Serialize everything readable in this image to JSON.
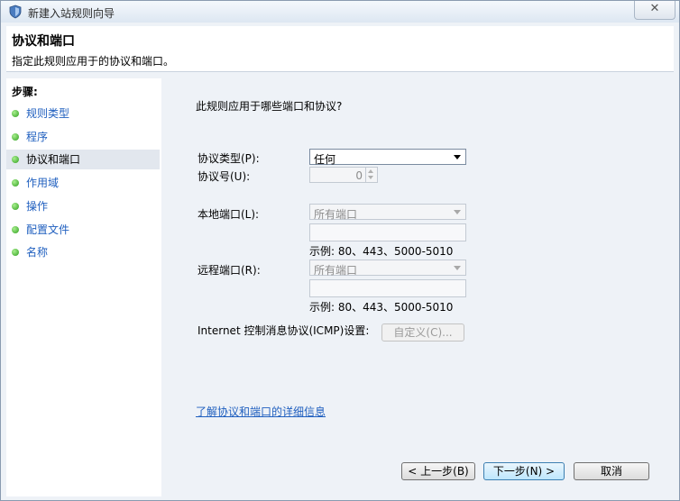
{
  "window": {
    "title": "新建入站规则向导",
    "close_symbol": "✕"
  },
  "header": {
    "title": "协议和端口",
    "subtitle": "指定此规则应用于的协议和端口。"
  },
  "sidebar": {
    "steps_label": "步骤:",
    "items": [
      {
        "label": "规则类型"
      },
      {
        "label": "程序"
      },
      {
        "label": "协议和端口"
      },
      {
        "label": "作用域"
      },
      {
        "label": "操作"
      },
      {
        "label": "配置文件"
      },
      {
        "label": "名称"
      }
    ],
    "current_index": 2
  },
  "form": {
    "question": "此规则应用于哪些端口和协议?",
    "protocol_type_label": "协议类型(P):",
    "protocol_type_value": "任何",
    "protocol_number_label": "协议号(U):",
    "protocol_number_value": "0",
    "local_port_label": "本地端口(L):",
    "local_port_value": "所有端口",
    "local_example": "示例: 80、443、5000-5010",
    "remote_port_label": "远程端口(R):",
    "remote_port_value": "所有端口",
    "remote_example": "示例: 80、443、5000-5010",
    "icmp_label": "Internet 控制消息协议(ICMP)设置:",
    "customize_button": "自定义(C)...",
    "learn_more_link": "了解协议和端口的详细信息"
  },
  "footer": {
    "back_button": "< 上一步(B)",
    "next_button": "下一步(N) >",
    "cancel_button": "取消"
  },
  "colors": {
    "link": "#1f5fbf",
    "step_dot": "#2f9f1f"
  },
  "icons": {
    "window": "shield-icon",
    "close": "close-icon"
  }
}
